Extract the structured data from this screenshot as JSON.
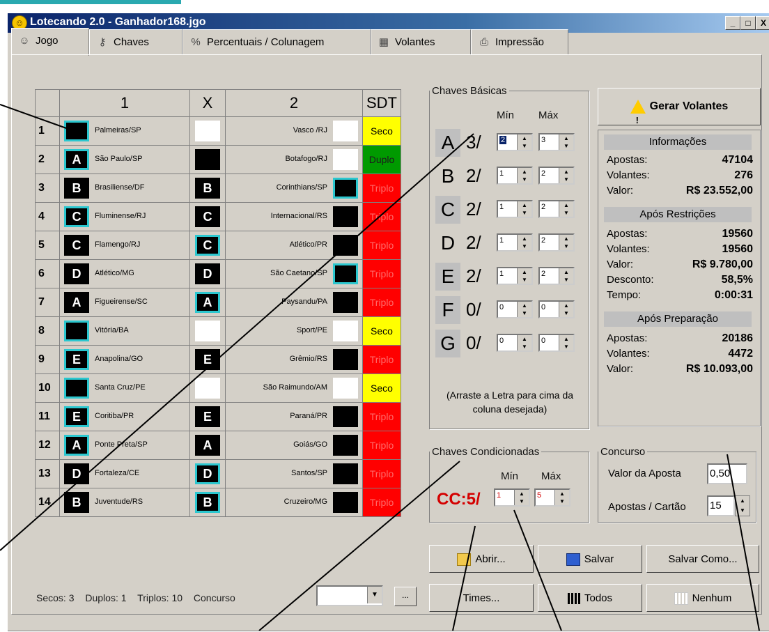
{
  "window": {
    "title": "Lotecando 2.0 - Ganhador168.jgo",
    "controls": [
      "_",
      "□",
      "X"
    ]
  },
  "tabs": [
    {
      "label": "Jogo",
      "icon": "smiley-icon"
    },
    {
      "label": "Chaves",
      "icon": "keys-icon"
    },
    {
      "label": "Percentuais / Colunagem",
      "icon": "percent-icon"
    },
    {
      "label": "Volantes",
      "icon": "grid-icon"
    },
    {
      "label": "Impressão",
      "icon": "printer-icon"
    }
  ],
  "grid": {
    "headers": {
      "num": "",
      "col1": "1",
      "colx": "X",
      "col2": "2",
      "sdt": "SDT"
    },
    "rows": [
      {
        "n": "1",
        "team1": "Palmeiras/SP",
        "team2": "Vasco /RJ",
        "sdt": "Seco"
      },
      {
        "n": "2",
        "team1": "São Paulo/SP",
        "team2": "Botafogo/RJ",
        "sdt": "Duplo"
      },
      {
        "n": "3",
        "team1": "Brasiliense/DF",
        "team2": "Corinthians/SP",
        "sdt": "Triplo"
      },
      {
        "n": "4",
        "team1": "Fluminense/RJ",
        "team2": "Internacional/RS",
        "sdt": "Triplo"
      },
      {
        "n": "5",
        "team1": "Flamengo/RJ",
        "team2": "Atlético/PR",
        "sdt": "Triplo"
      },
      {
        "n": "6",
        "team1": "Atlético/MG",
        "team2": "São Caetano/SP",
        "sdt": "Triplo"
      },
      {
        "n": "7",
        "team1": "Figueirense/SC",
        "team2": "Paysandu/PA",
        "sdt": "Triplo"
      },
      {
        "n": "8",
        "team1": "Vitória/BA",
        "team2": "Sport/PE",
        "sdt": "Seco"
      },
      {
        "n": "9",
        "team1": "Anapolina/GO",
        "team2": "Grêmio/RS",
        "sdt": "Triplo"
      },
      {
        "n": "10",
        "team1": "Santa Cruz/PE",
        "team2": "São Raimundo/AM",
        "sdt": "Seco"
      },
      {
        "n": "11",
        "team1": "Coritiba/PR",
        "team2": "Paraná/PR",
        "sdt": "Triplo"
      },
      {
        "n": "12",
        "team1": "Ponte Preta/SP",
        "team2": "Goiás/GO",
        "sdt": "Triplo"
      },
      {
        "n": "13",
        "team1": "Fortaleza/CE",
        "team2": "Santos/SP",
        "sdt": "Triplo"
      },
      {
        "n": "14",
        "team1": "Juventude/RS",
        "team2": "Cruzeiro/MG",
        "sdt": "Triplo"
      }
    ],
    "cells": [
      [
        "",
        "",
        ""
      ],
      [
        "A",
        "",
        ""
      ],
      [
        "B",
        "B",
        ""
      ],
      [
        "C",
        "C",
        ""
      ],
      [
        "C",
        "C",
        ""
      ],
      [
        "D",
        "D",
        ""
      ],
      [
        "A",
        "A",
        ""
      ],
      [
        "",
        "",
        ""
      ],
      [
        "E",
        "E",
        ""
      ],
      [
        "",
        "",
        ""
      ],
      [
        "E",
        "E",
        ""
      ],
      [
        "A",
        "A",
        ""
      ],
      [
        "D",
        "D",
        ""
      ],
      [
        "B",
        "B",
        ""
      ]
    ]
  },
  "status": {
    "secos": "Secos: 3",
    "duplos": "Duplos: 1",
    "triplos": "Triplos: 10",
    "concurso_label": "Concurso",
    "dots": "..."
  },
  "chaves_basicas": {
    "legend": "Chaves Básicas",
    "min_label": "Mín",
    "max_label": "Máx",
    "rows": [
      {
        "letter": "A",
        "count": "3/",
        "min": "2",
        "max": "3"
      },
      {
        "letter": "B",
        "count": "2/",
        "min": "1",
        "max": "2"
      },
      {
        "letter": "C",
        "count": "2/",
        "min": "1",
        "max": "2"
      },
      {
        "letter": "D",
        "count": "2/",
        "min": "1",
        "max": "2"
      },
      {
        "letter": "E",
        "count": "2/",
        "min": "1",
        "max": "2"
      },
      {
        "letter": "F",
        "count": "0/",
        "min": "0",
        "max": "0"
      },
      {
        "letter": "G",
        "count": "0/",
        "min": "0",
        "max": "0"
      }
    ],
    "hint": "(Arraste a Letra para cima da coluna desejada)"
  },
  "gerar_button": "Gerar Volantes",
  "informacoes": {
    "header": "Informações",
    "apostas_label": "Apostas:",
    "apostas": "47104",
    "volantes_label": "Volantes:",
    "volantes": "276",
    "valor_label": "Valor:",
    "valor": "R$ 23.552,00"
  },
  "apos_restricoes": {
    "header": "Após Restrições",
    "apostas_label": "Apostas:",
    "apostas": "19560",
    "volantes_label": "Volantes:",
    "volantes": "19560",
    "valor_label": "Valor:",
    "valor": "R$ 9.780,00",
    "desconto_label": "Desconto:",
    "desconto": "58,5%",
    "tempo_label": "Tempo:",
    "tempo": "0:00:31"
  },
  "apos_preparacao": {
    "header": "Após Preparação",
    "apostas_label": "Apostas:",
    "apostas": "20186",
    "volantes_label": "Volantes:",
    "volantes": "4472",
    "valor_label": "Valor:",
    "valor": "R$ 10.093,00"
  },
  "chaves_condicionadas": {
    "legend": "Chaves Condicionadas",
    "min_label": "Mín",
    "max_label": "Máx",
    "cc_label": "CC:5/",
    "min": "1",
    "max": "5"
  },
  "concurso": {
    "legend": "Concurso",
    "valor_label": "Valor da Aposta",
    "valor": "0,50",
    "apostas_label": "Apostas / Cartão",
    "apostas": "15"
  },
  "buttons": {
    "abrir": "Abrir...",
    "salvar": "Salvar",
    "salvar_como": "Salvar Como...",
    "times": "Times...",
    "todos": "Todos",
    "nenhum": "Nenhum"
  },
  "colors": {
    "seco": "#ffff00",
    "duplo": "#009a00",
    "triplo": "#ff0000",
    "highlight": "#2bc7cf",
    "cc_red": "#d40000",
    "titlebar": "#0a246a"
  }
}
